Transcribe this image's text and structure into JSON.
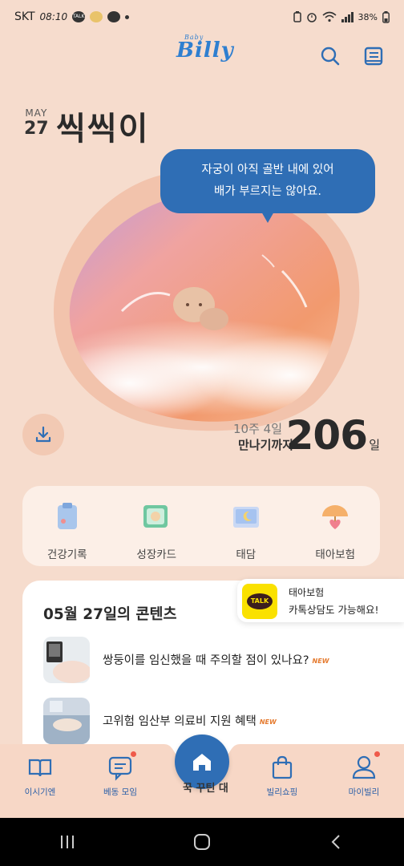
{
  "status_bar": {
    "carrier": "SKT",
    "time": "08:10",
    "talk_label": "TALK",
    "battery": "38%"
  },
  "header": {
    "logo_small": "Baby",
    "logo": "Billy",
    "search_icon": "search-icon",
    "book_icon": "book-icon"
  },
  "hero": {
    "month": "MAY",
    "day": "27",
    "baby_name": "씩씩이",
    "bubble_line1": "자궁이 아직 골반 내에 있어",
    "bubble_line2": "배가 부르지는 않아요.",
    "weeks": "10주 4일",
    "until_label": "만나기까지",
    "days_left": "206",
    "days_unit": "일"
  },
  "quick_menu": [
    {
      "label": "건강기록",
      "icon": "clipboard-icon"
    },
    {
      "label": "성장카드",
      "icon": "growth-card-icon"
    },
    {
      "label": "태담",
      "icon": "moon-book-icon"
    },
    {
      "label": "태아보험",
      "icon": "umbrella-heart-icon"
    }
  ],
  "content": {
    "title": "05월 27일의 콘텐츠",
    "items": [
      {
        "text": "쌍둥이를 임신했을 때 주의할 점이 있나요?",
        "badge": "NEW"
      },
      {
        "text": "고위험 임산부 의료비 지원 혜택",
        "badge": "NEW"
      }
    ]
  },
  "kakao_popup": {
    "badge": "TALK",
    "line1": "태아보험",
    "line2": "카톡상담도 가능해요!"
  },
  "bottom_nav": {
    "items": [
      {
        "label": "이시기엔",
        "icon": "book-open-icon",
        "dot": false
      },
      {
        "label": "베동 모임",
        "icon": "chat-icon",
        "dot": true
      },
      {
        "label": "빌리쇼핑",
        "icon": "shopping-bag-icon",
        "dot": false
      },
      {
        "label": "마이빌리",
        "icon": "person-icon",
        "dot": true
      }
    ],
    "home_icon": "home-icon",
    "home_under_text": "꾹 꾸틴 대"
  },
  "colors": {
    "accent": "#2f6eb5",
    "background": "#f6dccd",
    "badge_new": "#e57a2e",
    "kakao_yellow": "#fae100"
  }
}
